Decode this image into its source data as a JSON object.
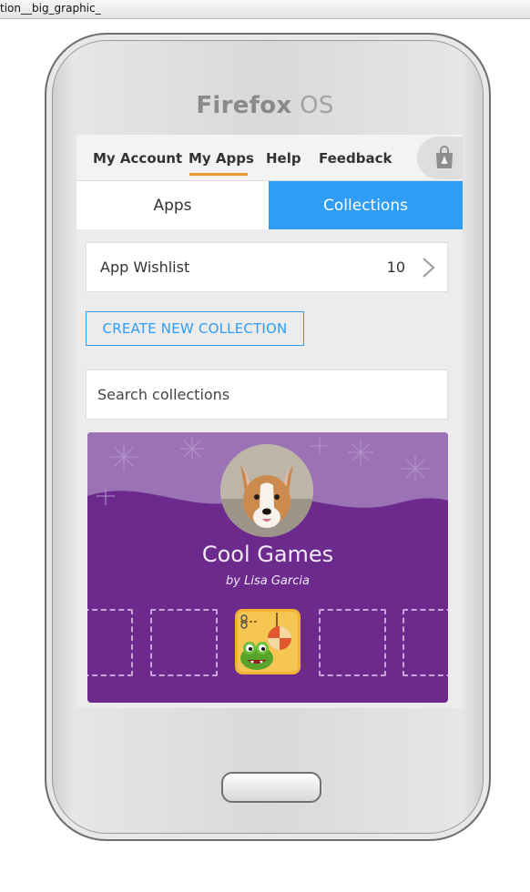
{
  "browser": {
    "tab_title": "tion__big_graphic_"
  },
  "phone": {
    "brand_primary": "Firefox",
    "brand_secondary": "OS"
  },
  "nav": {
    "items": [
      {
        "label": "My Account"
      },
      {
        "label": "My Apps",
        "active": true
      },
      {
        "label": "Help"
      },
      {
        "label": "Feedback"
      }
    ],
    "store_icon": "marketplace-bag-icon"
  },
  "segments": {
    "apps_label": "Apps",
    "collections_label": "Collections",
    "active": "Collections"
  },
  "wishlist": {
    "label": "App Wishlist",
    "count": "10"
  },
  "create_button": {
    "label": "CREATE NEW COLLECTION"
  },
  "search": {
    "placeholder": "Search collections"
  },
  "collection": {
    "title": "Cool Games",
    "author": "by Lisa Garcia",
    "avatar_icon": "corgi-avatar-image",
    "featured_app_icon": "cut-the-rope-icon"
  },
  "colors": {
    "accent_blue": "#2f9cf5",
    "nav_active_underline": "#f0962c",
    "collection_bg": "#6b2a8c"
  }
}
